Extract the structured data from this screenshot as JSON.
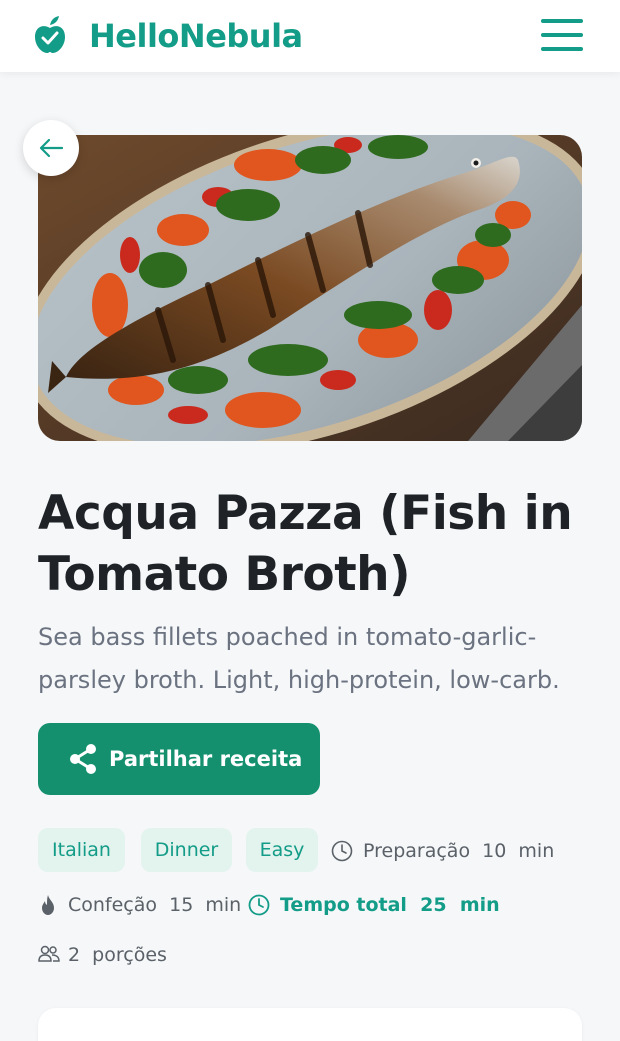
{
  "header": {
    "brand": "HelloNebula",
    "logo_icon": "apple-icon",
    "menu_icon": "hamburger-menu-icon"
  },
  "recipe": {
    "title": "Acqua Pazza (Fish in Tomato Broth)",
    "description": "Sea bass fillets poached in tomato-garlic-parsley broth. Light, high-protein, low-carb.",
    "share_label": "Partilhar receita",
    "tags": [
      "Italian",
      "Dinner",
      "Easy"
    ],
    "meta": {
      "prep": "Preparação  10  min",
      "cook": "Confeção  15  min",
      "total": "Tempo total  25  min",
      "servings": "2  porções"
    }
  },
  "colors": {
    "brand": "#139c87",
    "button": "#14906f",
    "tag_bg": "#e3f3ee",
    "page_bg": "#f5f7f9"
  }
}
